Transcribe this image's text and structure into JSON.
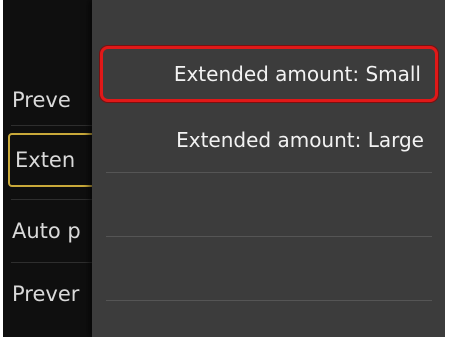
{
  "background_menu": {
    "items": [
      {
        "label": "Preve"
      },
      {
        "label": "Exten"
      },
      {
        "label": "Auto p"
      },
      {
        "label": "Prever"
      }
    ]
  },
  "submenu": {
    "options": [
      {
        "label": "Extended amount: Small",
        "selected": true
      },
      {
        "label": "Extended amount: Large",
        "selected": false
      }
    ]
  },
  "colors": {
    "highlight_border": "#e01818",
    "focus_border": "#c9a93a",
    "popup_bg": "#3c3c3c"
  }
}
